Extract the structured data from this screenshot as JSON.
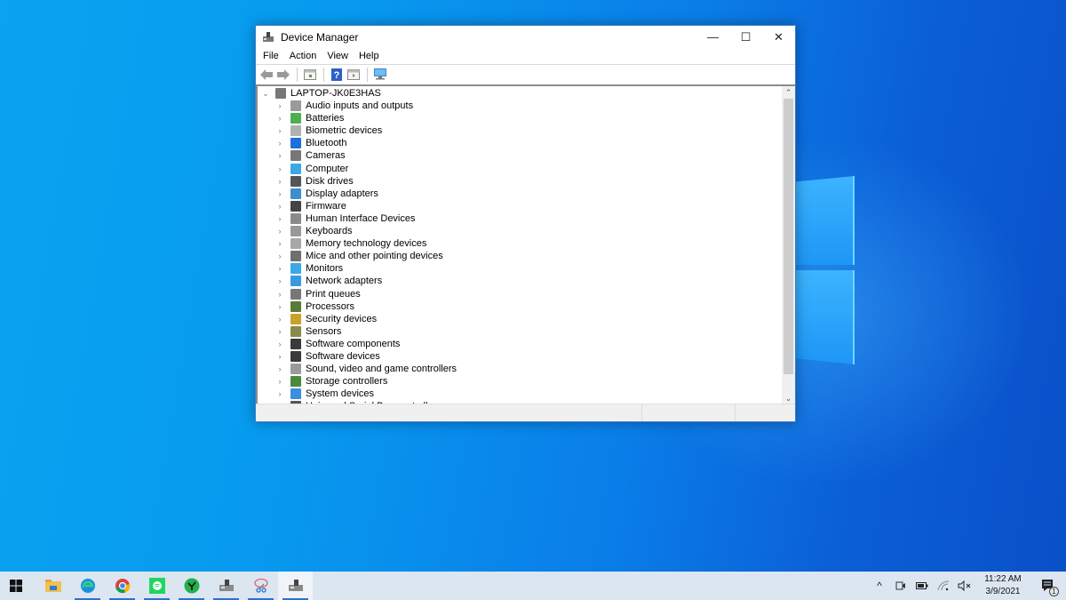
{
  "window": {
    "title": "Device Manager",
    "controls": {
      "minimize": "—",
      "maximize": "☐",
      "close": "✕"
    },
    "menu": [
      "File",
      "Action",
      "View",
      "Help"
    ],
    "toolbar": [
      "back-arrow",
      "forward-arrow",
      "properties",
      "help",
      "update-driver",
      "scan-monitor"
    ],
    "tree": {
      "root": "LAPTOP-JK0E3HAS",
      "categories": [
        {
          "label": "Audio inputs and outputs",
          "icon": "speaker-icon",
          "color": "#9a9a9a"
        },
        {
          "label": "Batteries",
          "icon": "battery-icon",
          "color": "#4caf50"
        },
        {
          "label": "Biometric devices",
          "icon": "fingerprint-icon",
          "color": "#b0b0b0"
        },
        {
          "label": "Bluetooth",
          "icon": "bluetooth-icon",
          "color": "#1e6fd9"
        },
        {
          "label": "Cameras",
          "icon": "webcam-icon",
          "color": "#777777"
        },
        {
          "label": "Computer",
          "icon": "computer-icon",
          "color": "#3ca8e8"
        },
        {
          "label": "Disk drives",
          "icon": "disk-drive-icon",
          "color": "#555555"
        },
        {
          "label": "Display adapters",
          "icon": "display-adapter-icon",
          "color": "#3a8fcf"
        },
        {
          "label": "Firmware",
          "icon": "firmware-icon",
          "color": "#444444"
        },
        {
          "label": "Human Interface Devices",
          "icon": "hid-icon",
          "color": "#8a8a8a"
        },
        {
          "label": "Keyboards",
          "icon": "keyboard-icon",
          "color": "#999999"
        },
        {
          "label": "Memory technology devices",
          "icon": "memory-card-icon",
          "color": "#a8a8a8"
        },
        {
          "label": "Mice and other pointing devices",
          "icon": "mouse-icon",
          "color": "#6f6f6f"
        },
        {
          "label": "Monitors",
          "icon": "monitor-icon",
          "color": "#3ca8e8"
        },
        {
          "label": "Network adapters",
          "icon": "network-adapter-icon",
          "color": "#3a9ae0"
        },
        {
          "label": "Print queues",
          "icon": "printer-icon",
          "color": "#777777"
        },
        {
          "label": "Processors",
          "icon": "processor-icon",
          "color": "#5a7a3a"
        },
        {
          "label": "Security devices",
          "icon": "security-key-icon",
          "color": "#c9a227"
        },
        {
          "label": "Sensors",
          "icon": "sensor-icon",
          "color": "#8a8a4a"
        },
        {
          "label": "Software components",
          "icon": "software-component-icon",
          "color": "#3a3a3a"
        },
        {
          "label": "Software devices",
          "icon": "software-device-icon",
          "color": "#3a3a3a"
        },
        {
          "label": "Sound, video and game controllers",
          "icon": "speaker-icon",
          "color": "#9a9a9a"
        },
        {
          "label": "Storage controllers",
          "icon": "storage-controller-icon",
          "color": "#4a8a3a"
        },
        {
          "label": "System devices",
          "icon": "system-devices-icon",
          "color": "#3a8fdf"
        },
        {
          "label": "Universal Serial Bus controllers",
          "icon": "usb-icon",
          "color": "#555555"
        }
      ]
    }
  },
  "taskbar": {
    "apps": [
      {
        "name": "start",
        "icon": "windows-start-icon",
        "running": false,
        "active": false
      },
      {
        "name": "file-explorer",
        "icon": "folder-icon",
        "running": false,
        "active": false
      },
      {
        "name": "edge",
        "icon": "edge-icon",
        "running": true,
        "active": false
      },
      {
        "name": "chrome",
        "icon": "chrome-icon",
        "running": true,
        "active": false
      },
      {
        "name": "spotify",
        "icon": "spotify-icon",
        "running": true,
        "active": false
      },
      {
        "name": "razer",
        "icon": "razer-icon",
        "running": true,
        "active": false
      },
      {
        "name": "device-manager-alt",
        "icon": "device-manager-icon",
        "running": true,
        "active": false
      },
      {
        "name": "snipping-tool",
        "icon": "snipping-tool-icon",
        "running": true,
        "active": false
      },
      {
        "name": "device-manager",
        "icon": "device-manager-icon",
        "running": true,
        "active": true
      }
    ],
    "tray": {
      "chevron": "^",
      "time": "11:22 AM",
      "date": "3/9/2021",
      "notification_count": "1"
    }
  }
}
